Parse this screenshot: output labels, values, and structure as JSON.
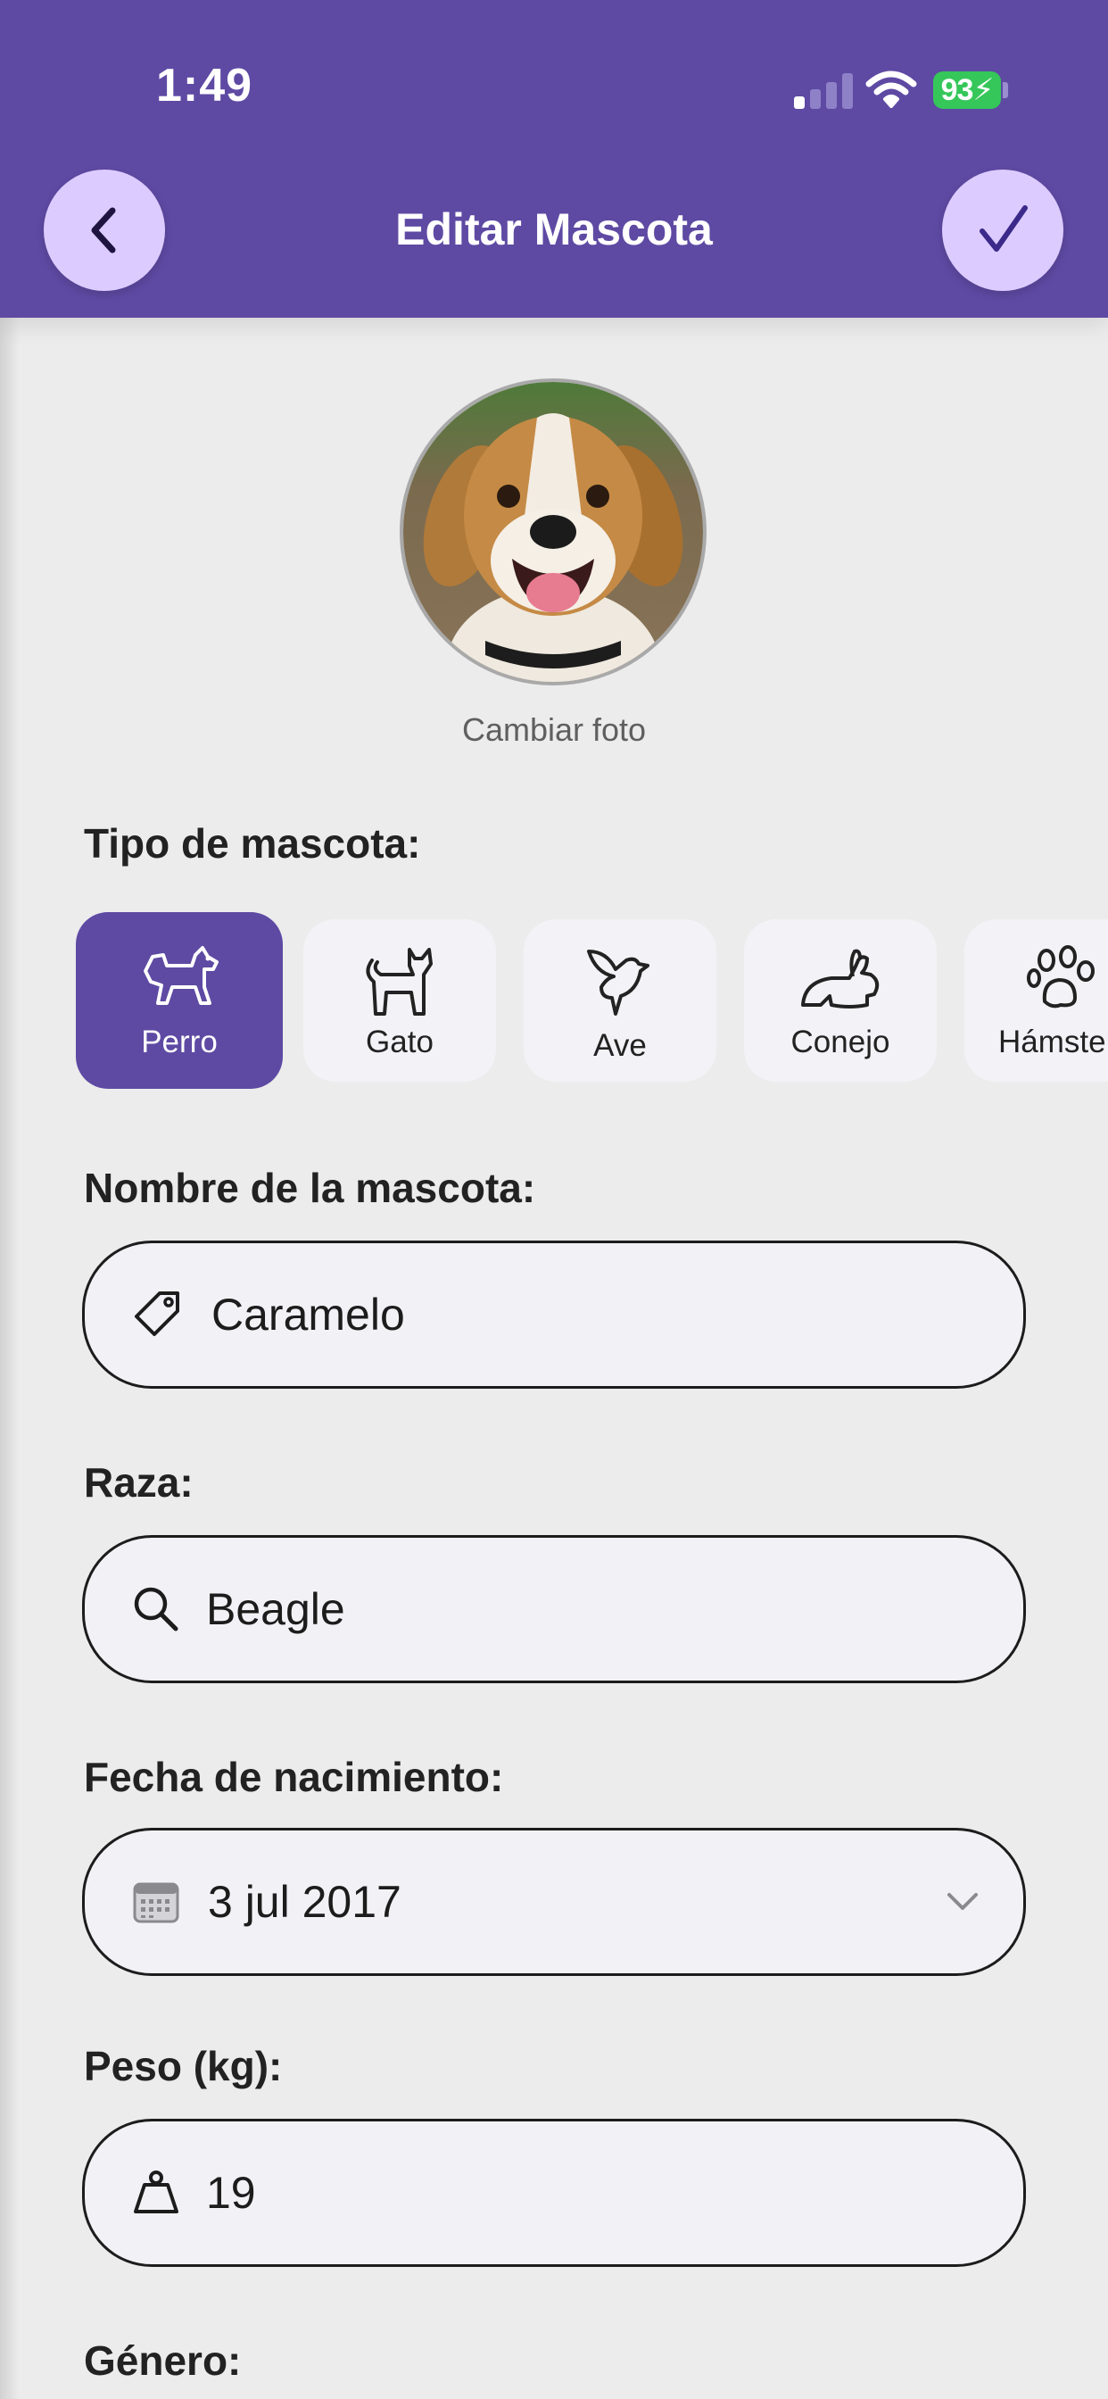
{
  "status_bar": {
    "time": "1:49",
    "battery": "93"
  },
  "header": {
    "title": "Editar Mascota",
    "back_icon": "chevron-left-icon",
    "confirm_icon": "checkmark-icon",
    "background_color": "#5e4aa3",
    "button_color": "#dccbff"
  },
  "photo": {
    "change_label": "Cambiar foto"
  },
  "pet_type": {
    "label": "Tipo de mascota:",
    "selected": "Perro",
    "options": [
      {
        "label": "Perro",
        "icon": "dog-icon"
      },
      {
        "label": "Gato",
        "icon": "cat-icon"
      },
      {
        "label": "Ave",
        "icon": "bird-icon"
      },
      {
        "label": "Conejo",
        "icon": "rabbit-icon"
      },
      {
        "label": "Hámster",
        "icon": "paw-icon"
      }
    ]
  },
  "form": {
    "name": {
      "label": "Nombre de la mascota:",
      "value": "Caramelo",
      "icon": "tag-icon"
    },
    "breed": {
      "label": "Raza:",
      "value": "Beagle",
      "icon": "search-icon"
    },
    "birthdate": {
      "label": "Fecha de nacimiento:",
      "value": "3 jul 2017",
      "icon": "calendar-icon"
    },
    "weight": {
      "label": "Peso (kg):",
      "value": "19",
      "icon": "weight-icon"
    },
    "gender": {
      "label": "Género:"
    }
  }
}
